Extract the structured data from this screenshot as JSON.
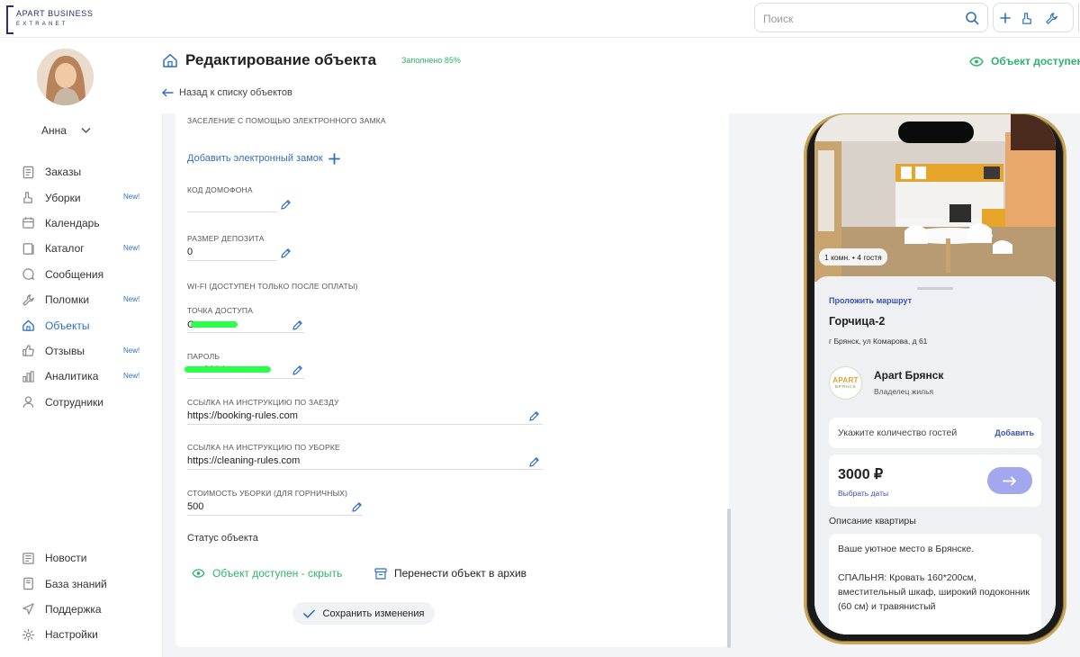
{
  "brand": {
    "line1": "APART BUSINESS",
    "line2": "EXTRANET",
    "accent": "#2a2d6e"
  },
  "search": {
    "placeholder": "Поиск"
  },
  "user": {
    "name": "Анна"
  },
  "sidebar": {
    "items": [
      {
        "label": "Заказы",
        "icon": "orders-icon",
        "badge": ""
      },
      {
        "label": "Уборки",
        "icon": "cleaning-icon",
        "badge": "New!"
      },
      {
        "label": "Календарь",
        "icon": "calendar-icon",
        "badge": ""
      },
      {
        "label": "Каталог",
        "icon": "catalog-icon",
        "badge": "New!"
      },
      {
        "label": "Сообщения",
        "icon": "messages-icon",
        "badge": ""
      },
      {
        "label": "Поломки",
        "icon": "wrench-icon",
        "badge": "New!"
      },
      {
        "label": "Объекты",
        "icon": "home-icon",
        "badge": "",
        "active": true
      },
      {
        "label": "Отзывы",
        "icon": "thumbs-up-icon",
        "badge": "New!"
      },
      {
        "label": "Аналитика",
        "icon": "analytics-icon",
        "badge": "New!"
      },
      {
        "label": "Сотрудники",
        "icon": "user-icon",
        "badge": ""
      }
    ],
    "bottom": [
      {
        "label": "Новости",
        "icon": "news-icon"
      },
      {
        "label": "База знаний",
        "icon": "book-icon"
      },
      {
        "label": "Поддержка",
        "icon": "send-icon"
      },
      {
        "label": "Настройки",
        "icon": "gear-icon"
      }
    ]
  },
  "header": {
    "title": "Редактирование объекта",
    "fill_status": "Заполнено 85%",
    "available": "Объект доступен",
    "back": "Назад к списку объектов"
  },
  "form": {
    "lock_section": "ЗАСЕЛЕНИЕ С ПОМОЩЬЮ ЭЛЕКТРОННОГО ЗАМКА",
    "add_lock": "Добавить электронный замок",
    "intercom_label": "КОД ДОМОФОНА",
    "intercom_value": "",
    "deposit_label": "РАЗМЕР ДЕПОЗИТА",
    "deposit_value": "0",
    "wifi_section": "WI-FI (ДОСТУПЕН ТОЛЬКО ПОСЛЕ ОПЛАТЫ)",
    "ap_label": "ТОЧКА ДОСТУПА",
    "ap_value": "G",
    "password_label": "ПАРОЛЬ",
    "password_value": "2014",
    "checkin_label": "ССЫЛКА НА ИНСТРУКЦИЮ ПО ЗАЕЗДУ",
    "checkin_value": "https://booking-rules.com",
    "cleaning_label": "ССЫЛКА НА ИНСТРУКЦИЮ ПО УБОРКЕ",
    "cleaning_value": "https://cleaning-rules.com",
    "cleaning_cost_label": "СТОИМОСТЬ УБОРКИ (ДЛЯ ГОРНИЧНЫХ)",
    "cleaning_cost_value": "500",
    "status_title": "Статус объекта",
    "available_hide": "Объект доступен - скрыть",
    "archive": "Перенести объект в архив",
    "save": "Сохранить изменения"
  },
  "preview": {
    "badge": "1 комн. • 4 гостя",
    "route": "Проложить маршрут",
    "name": "Горчица-2",
    "address": "г Брянск, ул Комарова, д 61",
    "owner_logo_1": "APART",
    "owner_logo_2": "БРЯНСК",
    "owner_name": "Apart Брянск",
    "owner_role": "Владелец жилья",
    "guests_placeholder": "Укажите количество гостей",
    "guests_add": "Добавить",
    "price": "3000 ₽",
    "choose_dates": "Выбрать даты",
    "desc_title": "Описание квартиры",
    "desc_p1": "Ваше уютное место в Брянске.",
    "desc_p2": "СПАЛЬНЯ: Кровать 160*200см, вместительный шкаф, широкий подоконник (60 см) и травянистый"
  },
  "colors": {
    "accent": "#2f6fc0",
    "success": "#2fb36b",
    "link": "#3b52b6"
  }
}
